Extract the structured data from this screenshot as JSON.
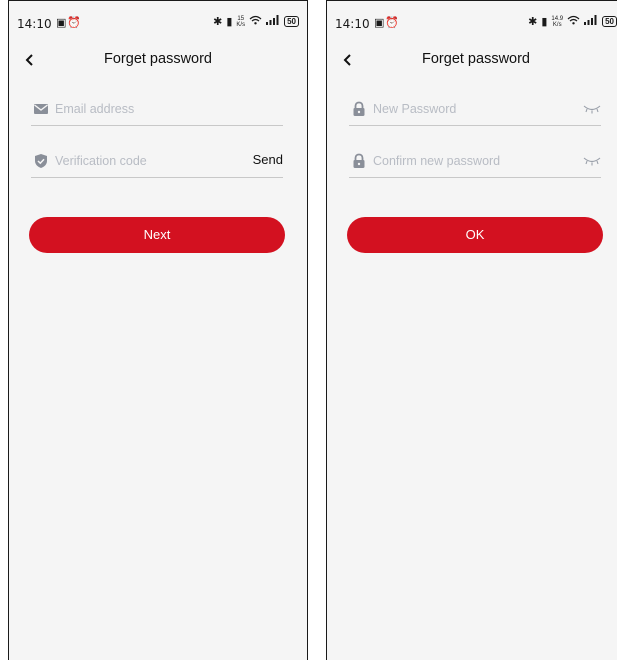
{
  "colors": {
    "accent": "#d31120",
    "placeholder": "#b8bcc4",
    "icon": "#8a8f99",
    "background": "#f5f5f5"
  },
  "status_bar": {
    "left": {
      "time": "14:10",
      "speed_top": "15",
      "speed_bottom": "K/s",
      "battery": "50"
    },
    "right": {
      "time": "14:10",
      "speed_top": "14.9",
      "speed_bottom": "K/s",
      "battery": "50"
    }
  },
  "left_screen": {
    "title": "Forget password",
    "email_placeholder": "Email address",
    "code_placeholder": "Verification code",
    "send_label": "Send",
    "next_label": "Next"
  },
  "right_screen": {
    "title": "Forget password",
    "new_password_placeholder": "New Password",
    "confirm_password_placeholder": "Confirm new password",
    "ok_label": "OK"
  },
  "icons": {
    "back": "back-icon",
    "email": "mail-icon",
    "code": "shield-icon",
    "password": "lock-icon",
    "visibility": "eye-closed-icon"
  }
}
